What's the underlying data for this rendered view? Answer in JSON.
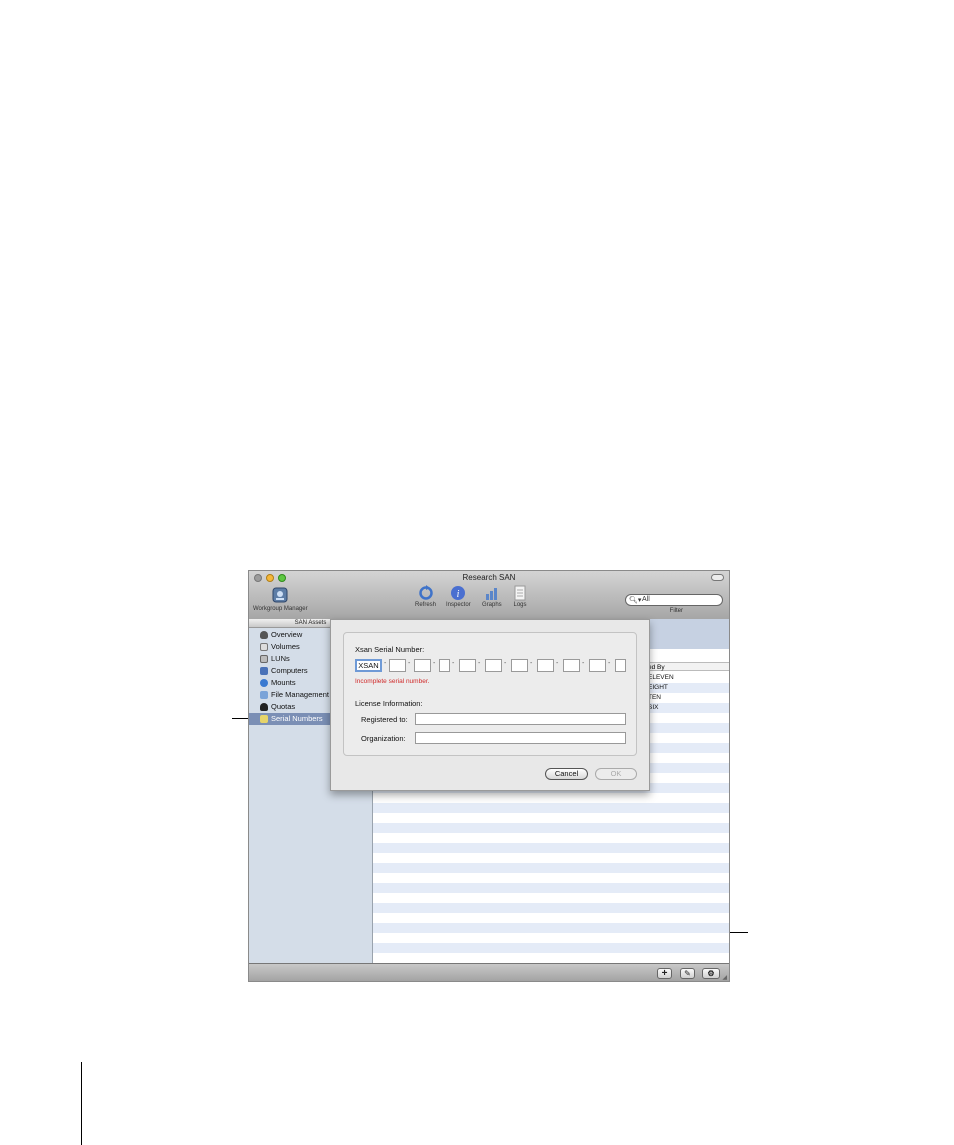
{
  "window": {
    "title": "Research SAN"
  },
  "toolbar": {
    "workgroup_manager": "Workgroup Manager",
    "refresh": "Refresh",
    "inspector": "Inspector",
    "graphs": "Graphs",
    "logs": "Logs",
    "search_placeholder": "All",
    "filter_label": "Filter"
  },
  "sidebar": {
    "header": "SAN Assets",
    "items": [
      {
        "label": "Overview",
        "icon": "shield-icon"
      },
      {
        "label": "Volumes",
        "icon": "volume-icon"
      },
      {
        "label": "LUNs",
        "icon": "lun-icon"
      },
      {
        "label": "Computers",
        "icon": "computer-icon"
      },
      {
        "label": "Mounts",
        "icon": "mount-icon"
      },
      {
        "label": "File Management",
        "icon": "file-icon"
      },
      {
        "label": "Quotas",
        "icon": "person-icon"
      },
      {
        "label": "Serial Numbers",
        "icon": "serial-icon",
        "selected": true
      }
    ]
  },
  "table": {
    "column_header": "ed By",
    "rows": [
      "ELEVEN",
      "EIGHT",
      "TEN",
      "SIX"
    ]
  },
  "dialog": {
    "serial_label": "Xsan Serial Number:",
    "serial_first_segment": "XSAN",
    "error": "Incomplete serial number.",
    "license_label": "License Information:",
    "registered_label": "Registered to:",
    "organization_label": "Organization:",
    "registered_value": "",
    "organization_value": "",
    "cancel": "Cancel",
    "ok": "OK"
  },
  "bottom_bar": {
    "add": "+",
    "edit": "✎",
    "action": "⚙"
  },
  "colors": {
    "selection": "#7b8fb5",
    "error": "#d02a2a",
    "focus": "#6f9ad6"
  }
}
